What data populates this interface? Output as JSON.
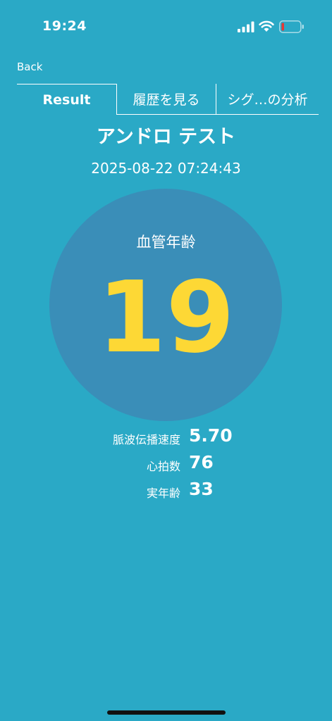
{
  "status_bar": {
    "time": "19:24",
    "icons": [
      "cellular-signal-icon",
      "wifi-icon",
      "battery-low-icon"
    ],
    "battery_color": "#e53935"
  },
  "nav": {
    "back_label": "Back"
  },
  "tabs": [
    {
      "label": "Result",
      "selected": true
    },
    {
      "label": "履歴を見る",
      "selected": false
    },
    {
      "label": "シグ…の分析",
      "selected": false
    }
  ],
  "result": {
    "name": "アンドロ テスト",
    "timestamp": "2025-08-22 07:24:43",
    "circle_label": "血管年齢",
    "vascular_age": "19"
  },
  "metrics": [
    {
      "label": "脈波伝播速度",
      "value": "5.70"
    },
    {
      "label": "心拍数",
      "value": "76"
    },
    {
      "label": "実年齢",
      "value": "33"
    }
  ],
  "colors": {
    "background": "#2aa9c6",
    "circle": "#3a8eb8",
    "accent_number": "#fdd835",
    "text": "#ffffff"
  }
}
